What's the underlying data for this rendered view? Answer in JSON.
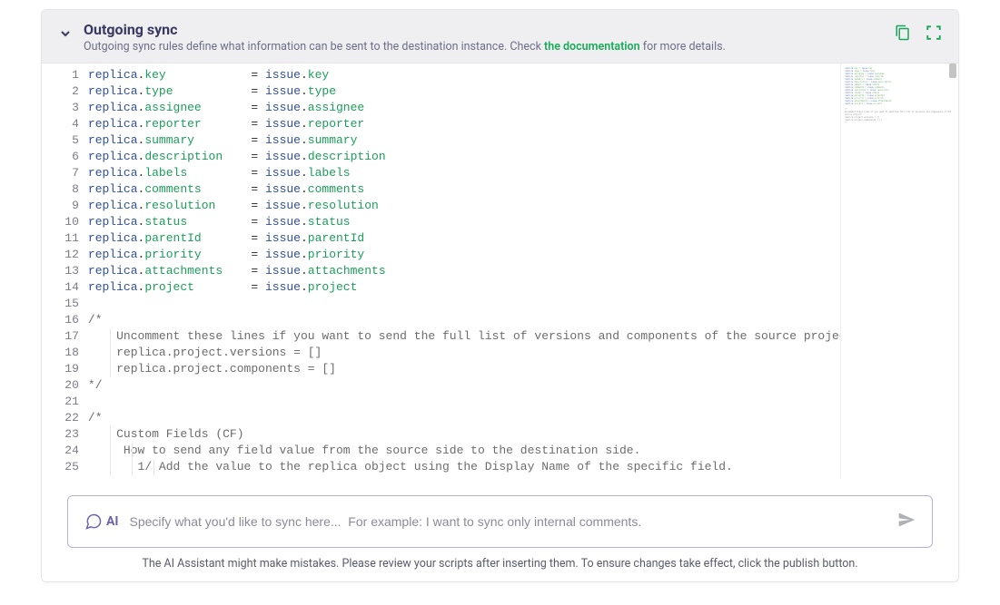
{
  "header": {
    "title": "Outgoing sync",
    "subtitle_prefix": "Outgoing sync rules define what information can be sent to the destination instance. Check ",
    "doc_link_text": "the documentation",
    "subtitle_suffix": " for more details."
  },
  "code": {
    "assignments": [
      {
        "left_obj": "replica",
        "left_prop": "key",
        "right_obj": "issue",
        "right_prop": "key"
      },
      {
        "left_obj": "replica",
        "left_prop": "type",
        "right_obj": "issue",
        "right_prop": "type"
      },
      {
        "left_obj": "replica",
        "left_prop": "assignee",
        "right_obj": "issue",
        "right_prop": "assignee"
      },
      {
        "left_obj": "replica",
        "left_prop": "reporter",
        "right_obj": "issue",
        "right_prop": "reporter"
      },
      {
        "left_obj": "replica",
        "left_prop": "summary",
        "right_obj": "issue",
        "right_prop": "summary"
      },
      {
        "left_obj": "replica",
        "left_prop": "description",
        "right_obj": "issue",
        "right_prop": "description"
      },
      {
        "left_obj": "replica",
        "left_prop": "labels",
        "right_obj": "issue",
        "right_prop": "labels"
      },
      {
        "left_obj": "replica",
        "left_prop": "comments",
        "right_obj": "issue",
        "right_prop": "comments"
      },
      {
        "left_obj": "replica",
        "left_prop": "resolution",
        "right_obj": "issue",
        "right_prop": "resolution"
      },
      {
        "left_obj": "replica",
        "left_prop": "status",
        "right_obj": "issue",
        "right_prop": "status"
      },
      {
        "left_obj": "replica",
        "left_prop": "parentId",
        "right_obj": "issue",
        "right_prop": "parentId"
      },
      {
        "left_obj": "replica",
        "left_prop": "priority",
        "right_obj": "issue",
        "right_prop": "priority"
      },
      {
        "left_obj": "replica",
        "left_prop": "attachments",
        "right_obj": "issue",
        "right_prop": "attachments"
      },
      {
        "left_obj": "replica",
        "left_prop": "project",
        "right_obj": "issue",
        "right_prop": "project"
      }
    ],
    "block1": {
      "open": "/*",
      "l1": "    Uncomment these lines if you want to send the full list of versions and components of the source project.",
      "l2": "    replica.project.versions = []",
      "l3": "    replica.project.components = []",
      "close": "*/"
    },
    "block2": {
      "open": "/*",
      "l1": "    Custom Fields (CF)",
      "l2": "     How to send any field value from the source side to the destination side.",
      "l3": "       1/ Add the value to the replica object using the Display Name of the specific field."
    },
    "line_start": 1,
    "line_end": 25,
    "equals_col": 23
  },
  "ai": {
    "label": "AI",
    "placeholder": "Specify what you'd like to sync here...  For example: I want to sync only internal comments.",
    "note": "The AI Assistant might make mistakes. Please review your scripts after inserting them. To ensure changes take effect, click the publish button."
  }
}
